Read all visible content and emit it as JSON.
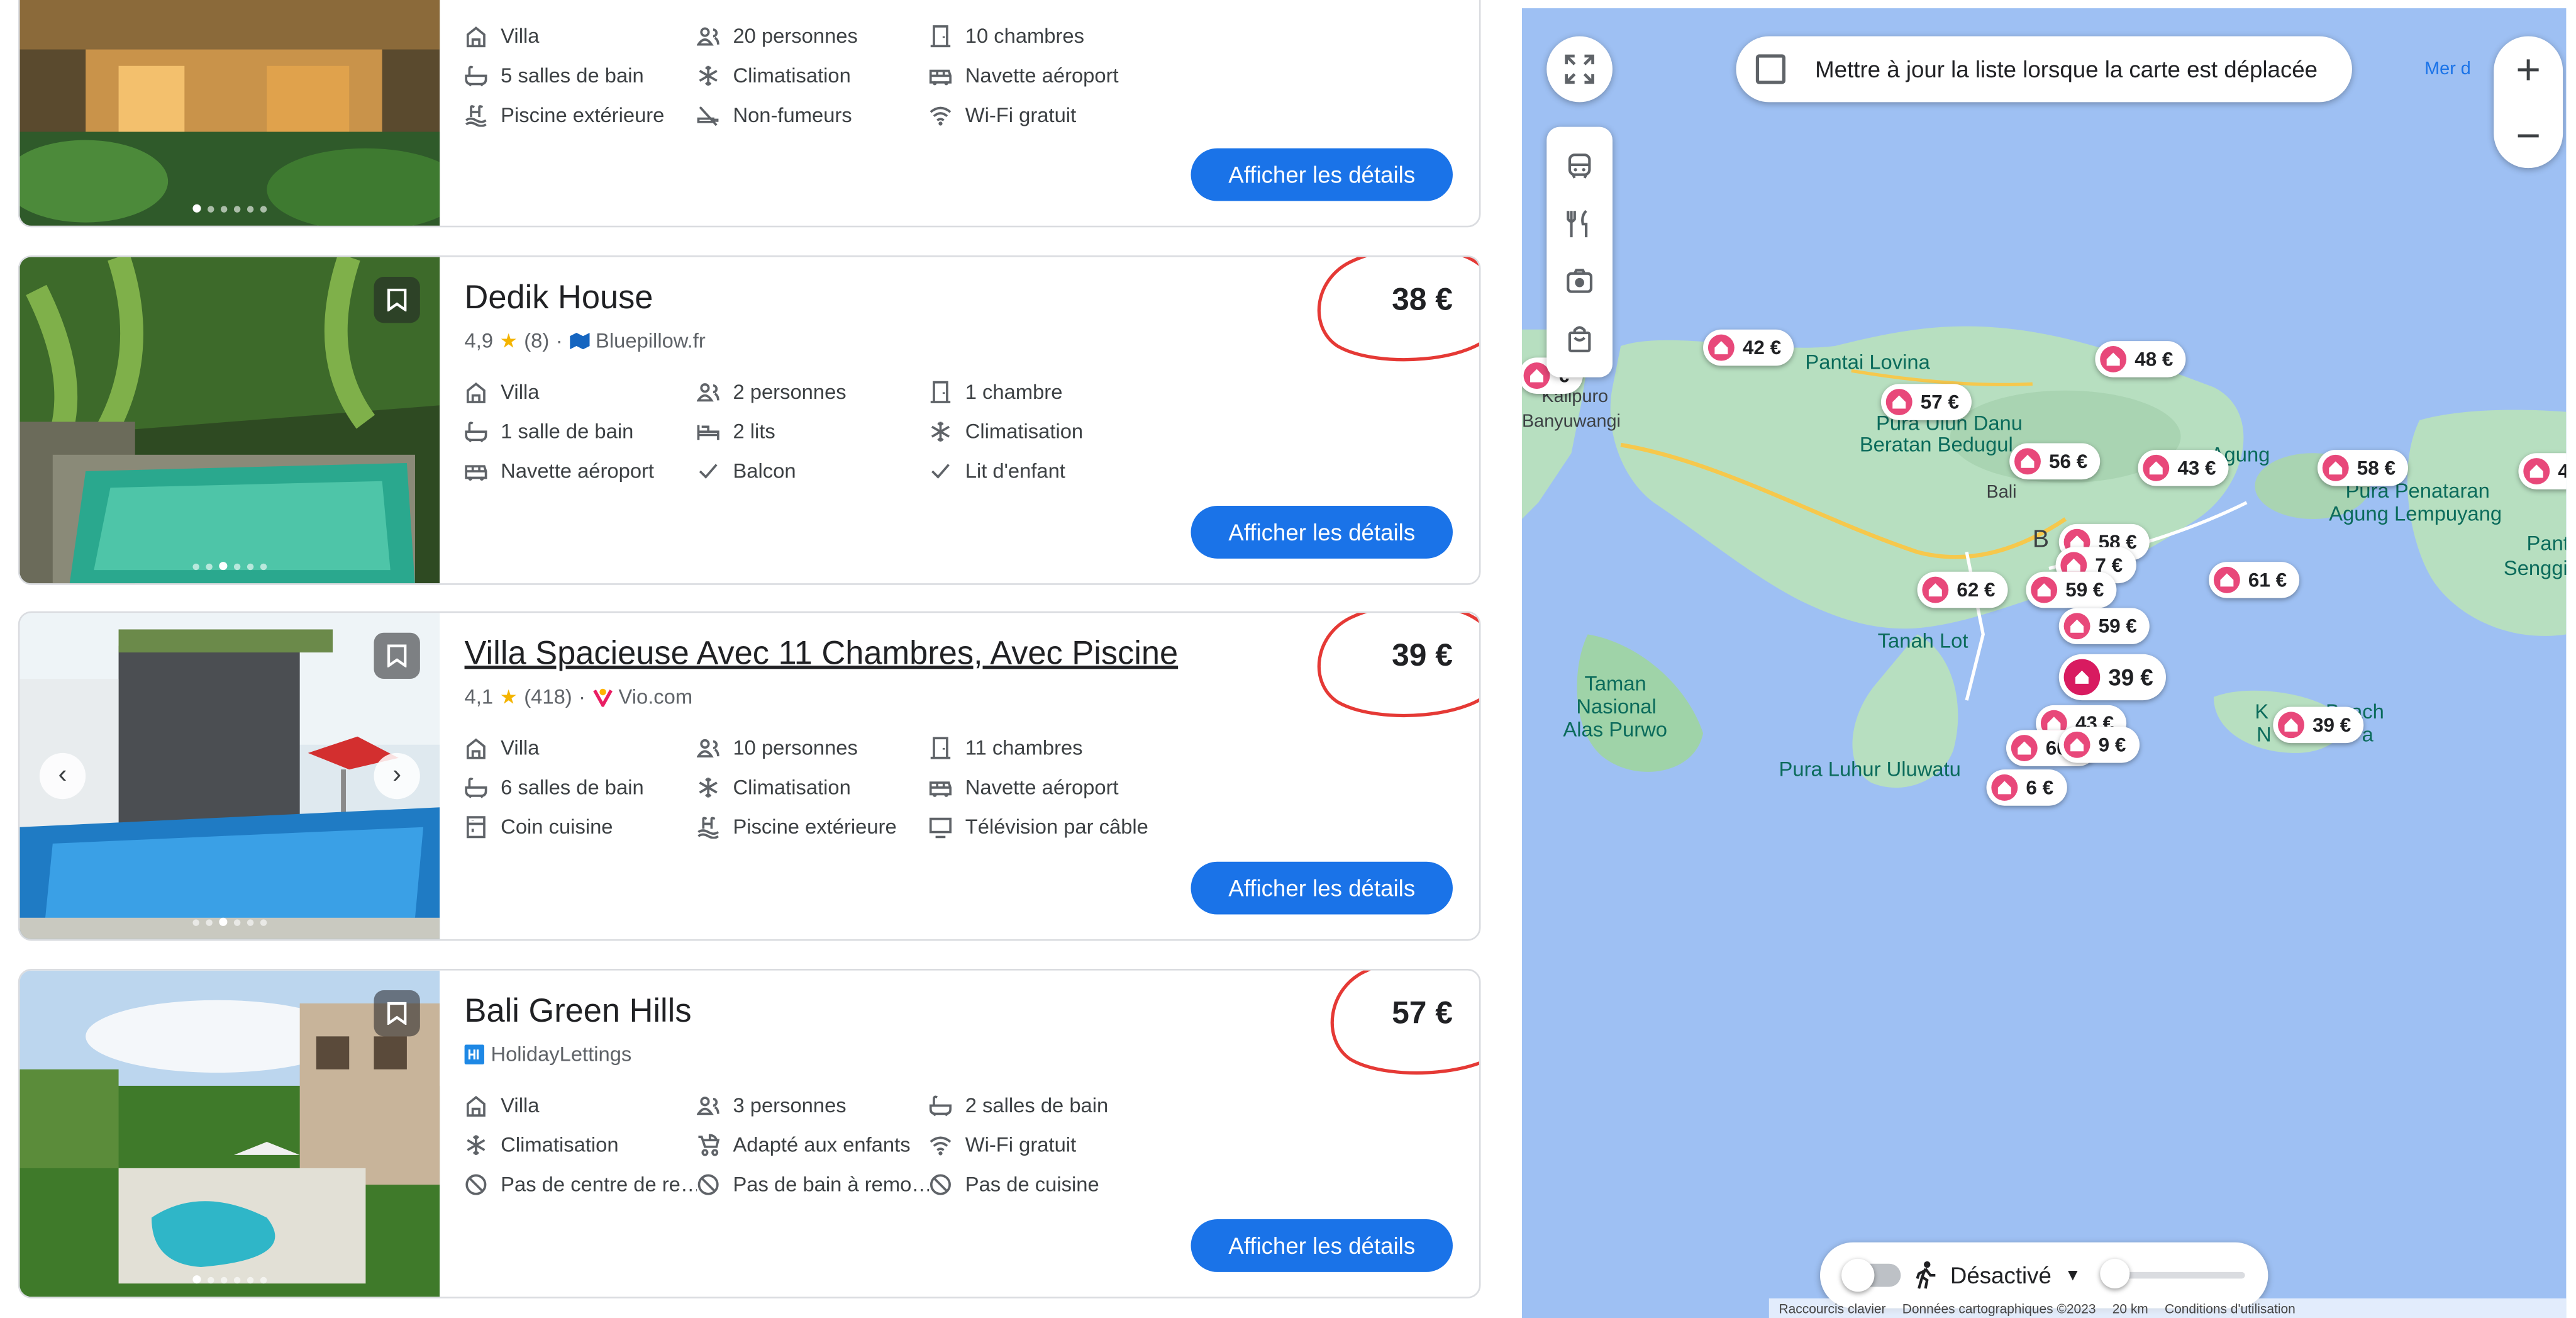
{
  "listings": [
    {
      "name": "",
      "features": [
        [
          "Villa",
          "20 personnes",
          "10 chambres"
        ],
        [
          "5 salles de bain",
          "Climatisation",
          "Navette aéroport"
        ],
        [
          "Piscine extérieure",
          "Non-fumeurs",
          "Wi-Fi gratuit"
        ]
      ],
      "feature_icons": [
        [
          "villa-icon",
          "people-icon",
          "door-icon"
        ],
        [
          "bath-icon",
          "snowflake-icon",
          "shuttle-icon"
        ],
        [
          "pool-icon",
          "no-smoking-icon",
          "wifi-icon"
        ]
      ],
      "button": "Afficher les détails"
    },
    {
      "name": "Dedik House",
      "rating": "4,9",
      "reviews": "(8)",
      "source": "Bluepillow.fr",
      "price": "38 €",
      "features": [
        [
          "Villa",
          "2 personnes",
          "1 chambre"
        ],
        [
          "1 salle de bain",
          "2 lits",
          "Climatisation"
        ],
        [
          "Navette aéroport",
          "Balcon",
          "Lit d'enfant"
        ]
      ],
      "feature_icons": [
        [
          "villa-icon",
          "people-icon",
          "door-icon"
        ],
        [
          "bath-icon",
          "bed-icon",
          "snowflake-icon"
        ],
        [
          "shuttle-icon",
          "check-icon",
          "check-icon"
        ]
      ],
      "button": "Afficher les détails"
    },
    {
      "name": "Villa Spacieuse Avec 11 Chambres, Avec Piscine",
      "rating": "4,1",
      "reviews": "(418)",
      "source": "Vio.com",
      "price": "39 €",
      "features": [
        [
          "Villa",
          "10 personnes",
          "11 chambres"
        ],
        [
          "6 salles de bain",
          "Climatisation",
          "Navette aéroport"
        ],
        [
          "Coin cuisine",
          "Piscine extérieure",
          "Télévision par câble"
        ]
      ],
      "feature_icons": [
        [
          "villa-icon",
          "people-icon",
          "door-icon"
        ],
        [
          "bath-icon",
          "snowflake-icon",
          "shuttle-icon"
        ],
        [
          "kitchen-icon",
          "pool-icon",
          "tv-icon"
        ]
      ],
      "button": "Afficher les détails"
    },
    {
      "name": "Bali Green Hills",
      "source": "HolidayLettings",
      "price": "57 €",
      "features": [
        [
          "Villa",
          "3 personnes",
          "2 salles de bain"
        ],
        [
          "Climatisation",
          "Adapté aux enfants",
          "Wi-Fi gratuit"
        ],
        [
          "Pas de centre de re…",
          "Pas de bain à remo…",
          "Pas de cuisine"
        ]
      ],
      "feature_icons": [
        [
          "villa-icon",
          "people-icon",
          "bath-icon"
        ],
        [
          "snowflake-icon",
          "stroller-icon",
          "wifi-icon"
        ],
        [
          "no-icon",
          "no-icon",
          "no-icon"
        ]
      ],
      "button": "Afficher les détails"
    }
  ],
  "map": {
    "update_label": "Mettre à jour la liste lorsque la carte est déplacée",
    "street_view_label": "Désactivé",
    "zoom_in": "+",
    "zoom_out": "−",
    "corner_label": "Mer d",
    "places": [
      "Pantai Lovina",
      "Kalipuro",
      "Banyuwangi",
      "Pura Ulun Danu",
      "Beratan Bedugul",
      "Bali",
      "Agung",
      "Pura Penataran",
      "Agung Lempuyang",
      "Pant",
      "Senggigi",
      "Tanah Lot",
      "Taman",
      "Nasional",
      "Alas Purwo",
      "Pura Luhur Uluwatu",
      "K",
      "Beach",
      "N",
      "a",
      "B"
    ],
    "pins": [
      "42 €",
      "48 €",
      "57 €",
      "56 €",
      "43 €",
      "58 €",
      "4",
      "58 €",
      "7 €",
      "62 €",
      "59 €",
      "61 €",
      "59 €",
      "39 €",
      "43 €",
      "66 €",
      "9 €",
      "39 €",
      "6 €",
      "€"
    ],
    "attribution": [
      "Raccourcis clavier",
      "Données cartographiques ©2023",
      "20 km",
      "Conditions d'utilisation"
    ]
  },
  "colors": {
    "accent": "#1a73e8",
    "pin": "#e8487a",
    "circle": "#e53935",
    "land": "#b7dfc0",
    "water": "#9ec0f3"
  }
}
